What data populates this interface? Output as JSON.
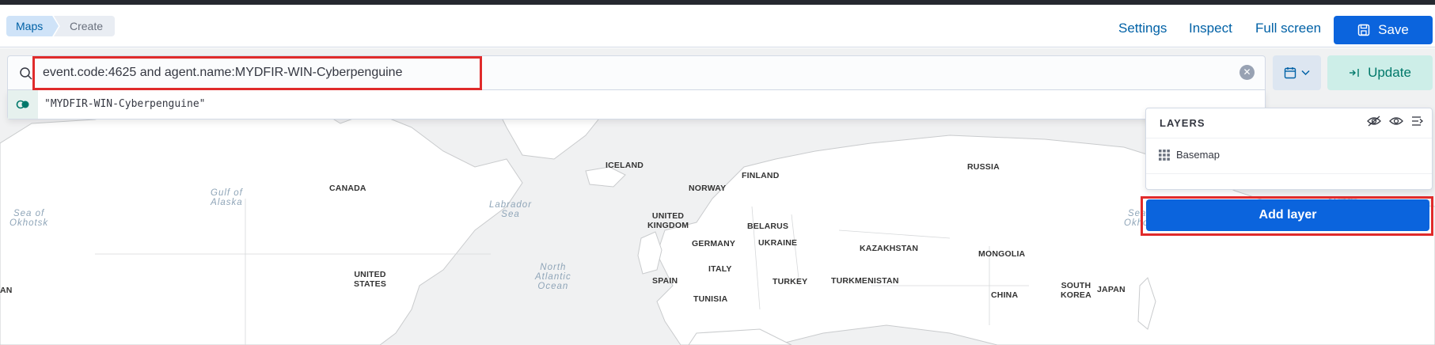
{
  "breadcrumbs": [
    "Maps",
    "Create"
  ],
  "header": {
    "settings_label": "Settings",
    "inspect_label": "Inspect",
    "fullscreen_label": "Full screen",
    "save_label": "Save"
  },
  "query": {
    "value": "event.code:4625 and agent.name:MYDFIR-WIN-Cyberpenguine",
    "suggestion": "\"MYDFIR-WIN-Cyberpenguine\""
  },
  "update_label": "Update",
  "layers": {
    "title": "LAYERS",
    "items": [
      {
        "label": "Basemap"
      }
    ],
    "add_label": "Add layer"
  },
  "map_labels": {
    "iceland": "ICELAND",
    "finland": "FINLAND",
    "russia": "RUSSIA",
    "canada": "CANADA",
    "norway": "NORWAY",
    "uk": "UNITED\nKINGDOM",
    "belarus": "BELARUS",
    "germany": "GERMANY",
    "ukraine": "UKRAINE",
    "kazakhstan": "KAZAKHSTAN",
    "mongolia": "MONGOLIA",
    "us": "UNITED\nSTATES",
    "italy": "ITALY",
    "spain": "SPAIN",
    "turkey": "TURKEY",
    "turkmenistan": "TURKMENISTAN",
    "south_korea": "SOUTH\nKOREA",
    "japan": "JAPAN",
    "china": "CHINA",
    "tunisia": "TUNISIA",
    "iran_partial": "AN",
    "gulf_alaska": "Gulf of\nAlaska",
    "sea_okhotsk_left": "Sea of\nOkhotsk",
    "sea_okhotsk_right": "Sea of\nOkhotsk",
    "labrador_sea": "Labrador\nSea",
    "north_atlantic": "North\nAtlantic\nOcean",
    "alaska_partial": "Alaska"
  }
}
